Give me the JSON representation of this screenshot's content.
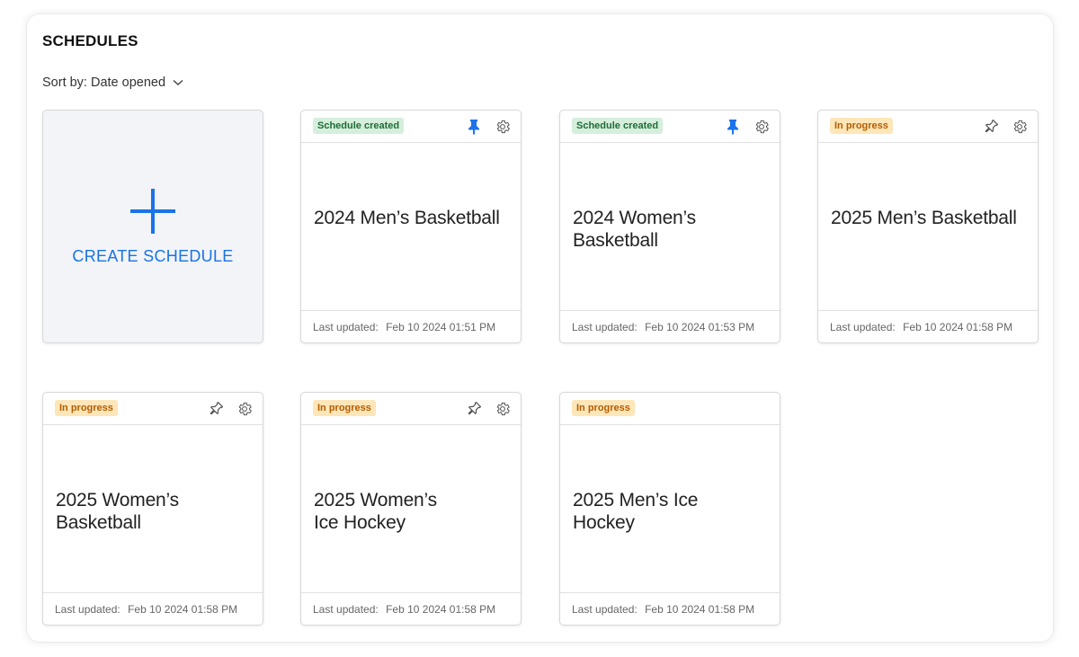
{
  "page": {
    "title": "SCHEDULES",
    "sort_label": "Sort by: Date opened"
  },
  "create_card": {
    "label": "CREATE SCHEDULE"
  },
  "colors": {
    "accent": "#1a73e8",
    "created_bg": "#d5efdc",
    "created_text": "#1f6b36",
    "progress_bg": "#fde6b8",
    "progress_text": "#b35c00"
  },
  "schedules": [
    {
      "status": "Schedule created",
      "title_line1": "2024 Men’s Basketball",
      "title_line2": "",
      "pinned": true,
      "show_pin": true,
      "show_settings": true,
      "updated_label": "Last updated:",
      "updated_value": "Feb 10 2024 01:51 PM"
    },
    {
      "status": "Schedule created",
      "title_line1": "2024 Women’s",
      "title_line2": "Basketball",
      "pinned": true,
      "show_pin": true,
      "show_settings": true,
      "updated_label": "Last updated:",
      "updated_value": "Feb 10 2024 01:53 PM"
    },
    {
      "status": "In progress",
      "title_line1": "2025 Men’s Basketball",
      "title_line2": "",
      "pinned": false,
      "show_pin": true,
      "show_settings": true,
      "updated_label": "Last updated:",
      "updated_value": "Feb 10 2024 01:58 PM"
    },
    {
      "status": "In progress",
      "title_line1": "2025 Women’s",
      "title_line2": "Basketball",
      "pinned": false,
      "show_pin": true,
      "show_settings": true,
      "updated_label": "Last updated:",
      "updated_value": "Feb 10 2024 01:58 PM"
    },
    {
      "status": "In progress",
      "title_line1": "2025 Women’s",
      "title_line2": "Ice Hockey",
      "pinned": false,
      "show_pin": true,
      "show_settings": true,
      "updated_label": "Last updated:",
      "updated_value": "Feb 10 2024 01:58 PM"
    },
    {
      "status": "In progress",
      "title_line1": "2025 Men’s Ice Hockey",
      "title_line2": "",
      "pinned": false,
      "show_pin": false,
      "show_settings": false,
      "updated_label": "Last updated:",
      "updated_value": "Feb 10 2024 01:58 PM"
    }
  ],
  "icons": {
    "create": "plus-icon",
    "sort": "chevron-down-icon",
    "pin": "pin-icon",
    "settings": "gear-icon"
  }
}
